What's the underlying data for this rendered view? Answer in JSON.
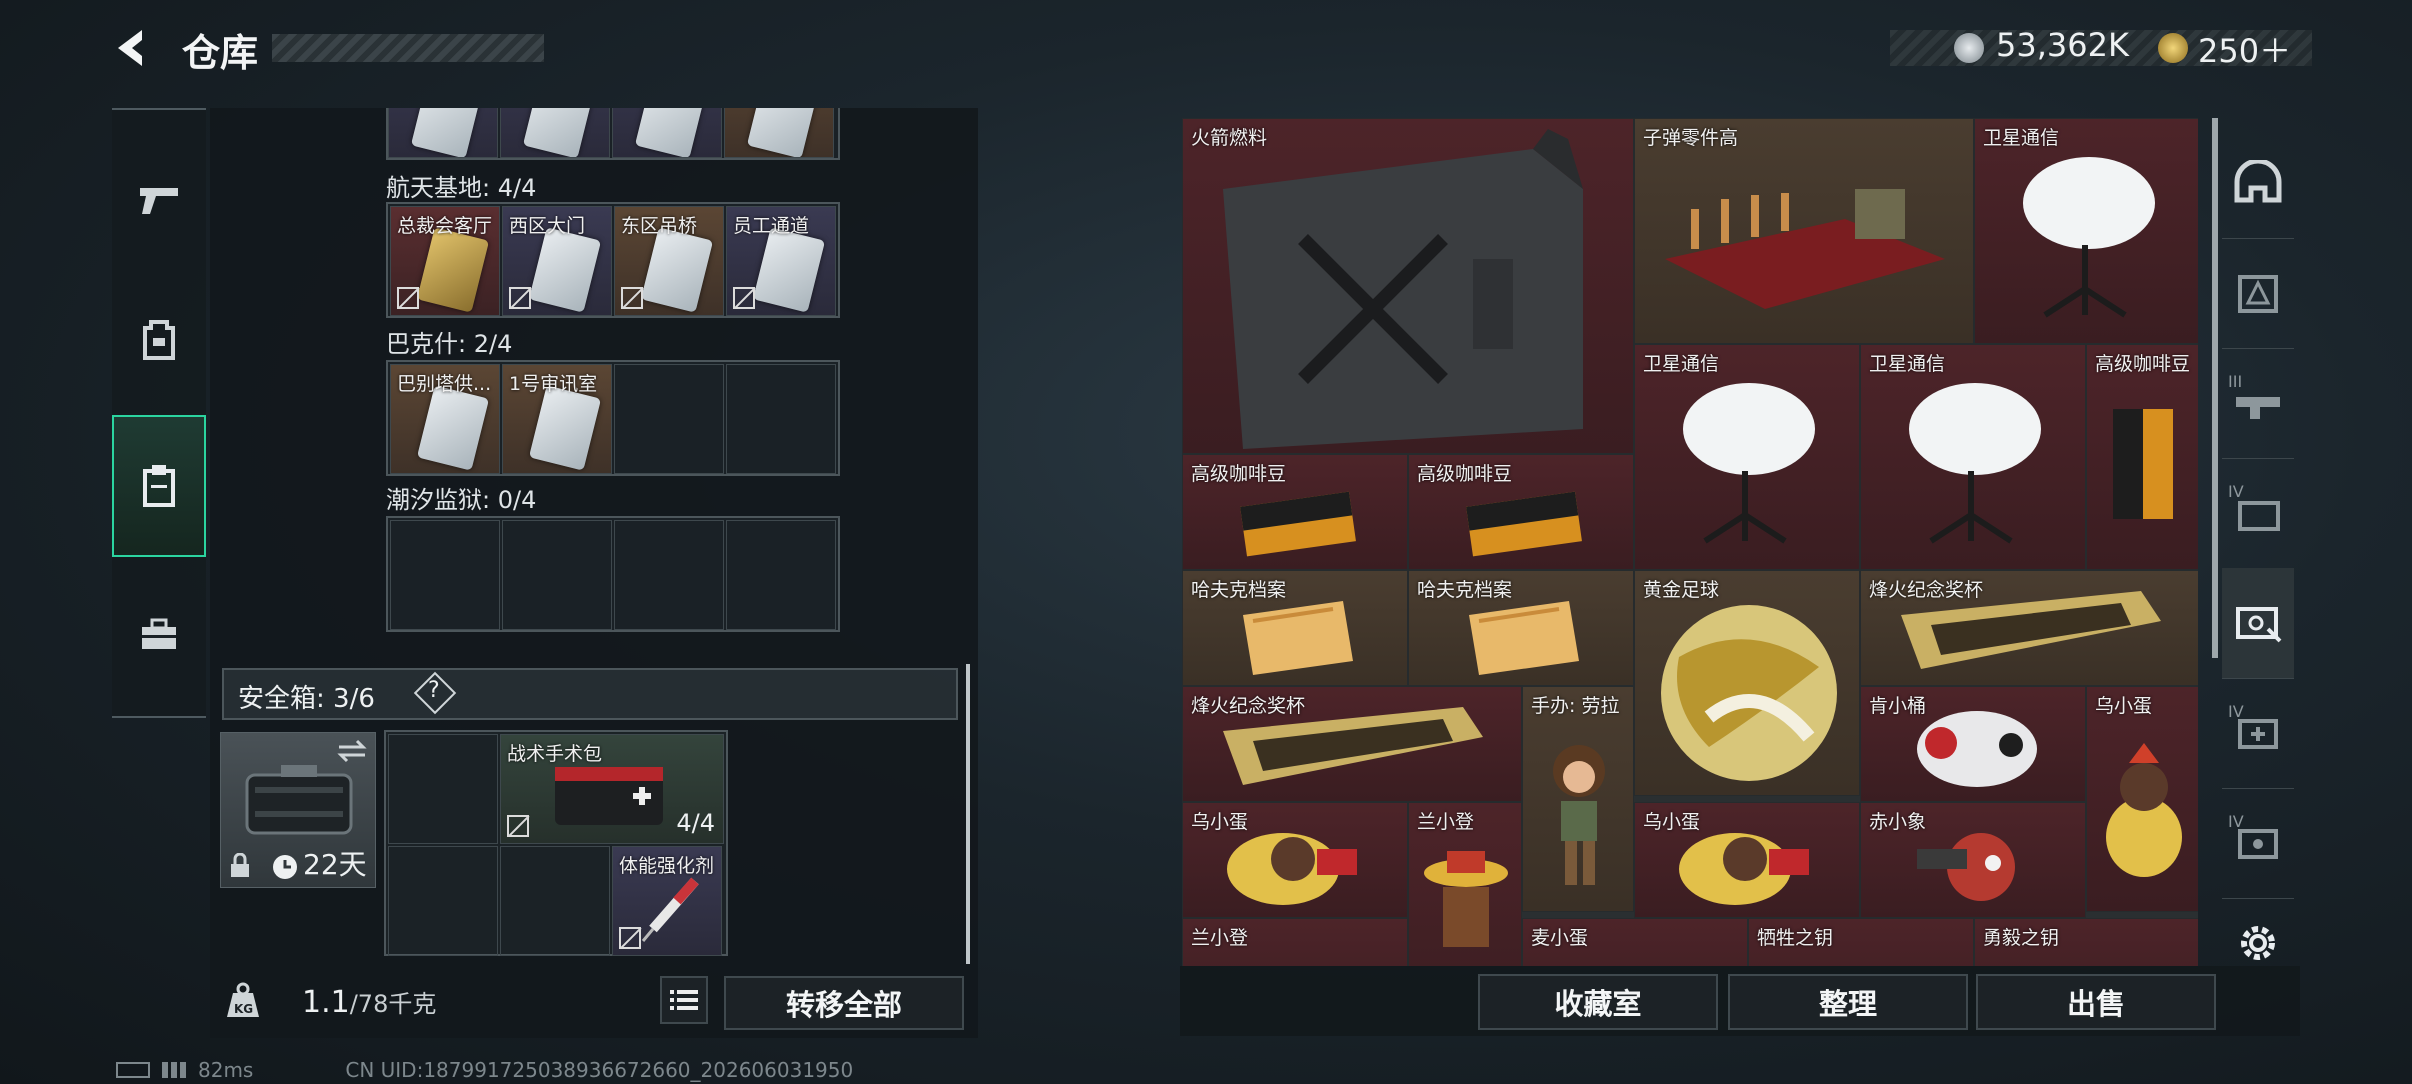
{
  "header": {
    "title": "仓库",
    "currency_main": "53,362K",
    "currency_secondary": "250＋"
  },
  "left_nav": {
    "items": [
      "pistol-icon",
      "backpack-icon",
      "clipboard-icon",
      "toolbox-icon"
    ],
    "active_index": 2
  },
  "keycard_sections": [
    {
      "label": "航天基地: 4/4",
      "cards": [
        "总裁会客厅",
        "西区大门",
        "东区吊桥",
        "员工通道"
      ]
    },
    {
      "label": "巴克什: 2/4",
      "cards": [
        "巴别塔供...",
        "1号审讯室"
      ]
    },
    {
      "label": "潮汐监狱: 0/4",
      "cards": []
    }
  ],
  "safe_box": {
    "label": "安全箱: 3/6",
    "help": "?",
    "duration": "22天",
    "medkit_label": "战术手术包",
    "medkit_count": "4/4",
    "booster_label": "体能强化剂"
  },
  "bottom_left": {
    "weight": "1.1",
    "weight_unit": "/78千克",
    "weight_icon_text": "KG",
    "transfer_all": "转移全部"
  },
  "status_bar": {
    "ping": "82ms",
    "uid": "CN UID:1879917250389366726​60_202606031950"
  },
  "stash_items": [
    {
      "label": "火箭燃料"
    },
    {
      "label": "子弹零件高"
    },
    {
      "label": "卫星通信"
    },
    {
      "label": "卫星通信"
    },
    {
      "label": "卫星通信"
    },
    {
      "label": "高级咖啡豆"
    },
    {
      "label": "高级咖啡豆"
    },
    {
      "label": "高级咖啡豆"
    },
    {
      "label": "哈夫克档案"
    },
    {
      "label": "哈夫克档案"
    },
    {
      "label": "黄金足球"
    },
    {
      "label": "烽火纪念奖杯"
    },
    {
      "label": "烽火纪念奖杯"
    },
    {
      "label": "手办: 劳拉"
    },
    {
      "label": "肯小桶"
    },
    {
      "label": "乌小蛋"
    },
    {
      "label": "乌小蛋"
    },
    {
      "label": "兰小登"
    },
    {
      "label": "乌小蛋"
    },
    {
      "label": "赤小象"
    },
    {
      "label": "兰小登"
    },
    {
      "label": "麦小蛋"
    },
    {
      "label": "牺牲之钥"
    },
    {
      "label": "勇毅之钥"
    }
  ],
  "right_nav": {
    "items": [
      "helmet-tab",
      "armor-tab",
      "rifle-tab",
      "backpack-tab",
      "keycard-tab",
      "medkit-tab",
      "misc-tab"
    ],
    "labels": [
      "",
      "",
      "III",
      "IV",
      "",
      "IV",
      "IV"
    ],
    "active_index": 4
  },
  "bottom_buttons": {
    "collection": "收藏室",
    "organize": "整理",
    "sell": "出售"
  },
  "colors": {
    "accent": "#2bd5a0",
    "red_cell": "#4d2429",
    "brown_cell": "#4a3d30"
  }
}
